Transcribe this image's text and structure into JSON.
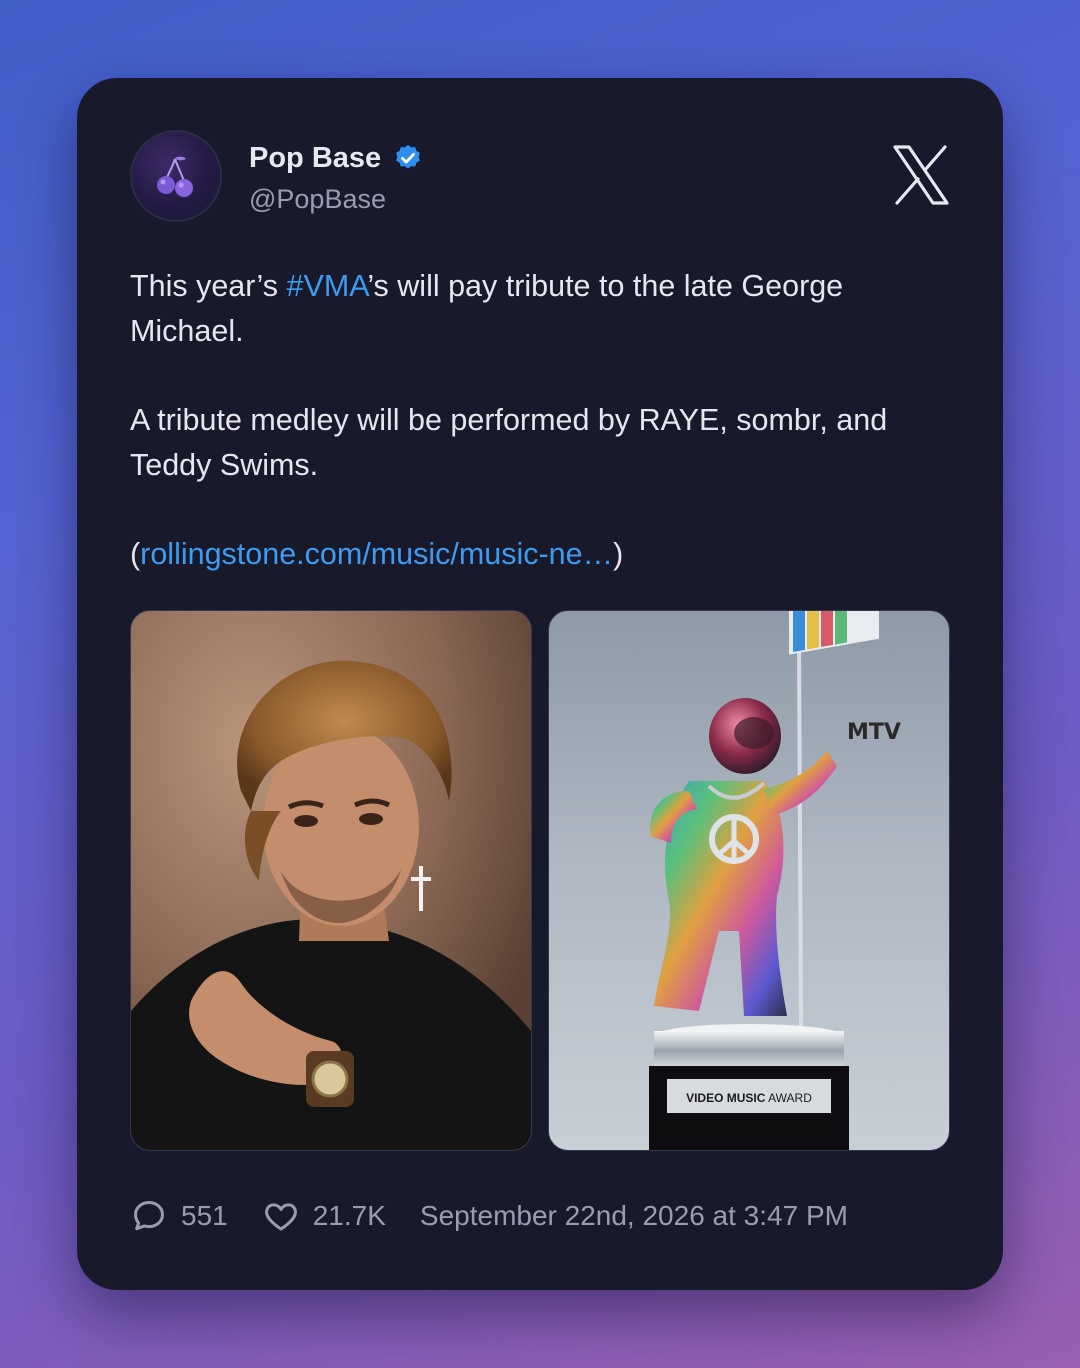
{
  "tweet": {
    "author": {
      "name": "Pop Base",
      "handle": "@PopBase",
      "verified": true,
      "avatar_icon": "cherry-icon"
    },
    "platform_icon": "x-logo-icon",
    "body": {
      "line1_before": "This year’s ",
      "hashtag": "#VMA",
      "line1_after": "’s will pay tribute to the late George Michael.",
      "paragraph2": "A tribute medley will be performed by RAYE, sombr, and Teddy Swims.",
      "link_open": "(",
      "link_text": "rollingstone.com/music/music-ne…",
      "link_close": ")"
    },
    "media": [
      {
        "description_icon": "george-michael-portrait-image"
      },
      {
        "description_icon": "vma-moonman-trophy-image",
        "plaque_text_bold": "VIDEO MUSIC",
        "plaque_text": " AWARD",
        "flag_text": "MTV"
      }
    ],
    "stats": {
      "replies": "551",
      "likes": "21.7K",
      "timestamp": "September 22nd, 2026 at 3:47 PM"
    }
  },
  "colors": {
    "card_bg": "#181a2b",
    "link": "#3d9bf0",
    "verified": "#2f8ff0",
    "text": "#e6e7ee",
    "muted": "#9a9cb0"
  }
}
